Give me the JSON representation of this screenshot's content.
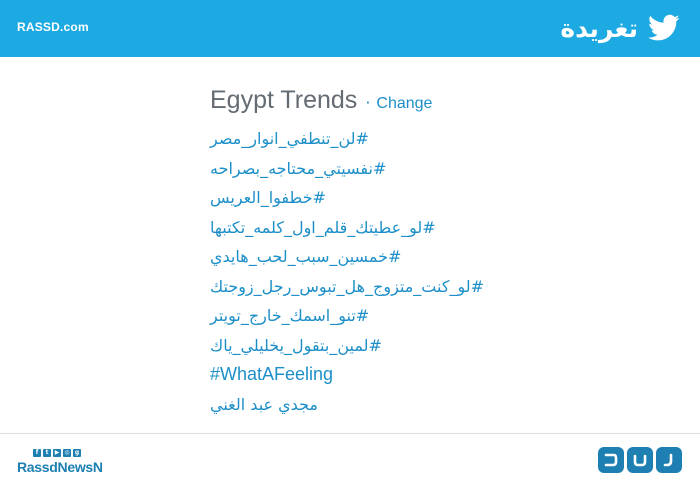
{
  "header": {
    "site_name": "RASSD.com",
    "brand_text": "تغريدة",
    "brand_icon": "twitter-bird-icon"
  },
  "trends": {
    "title": "Egypt Trends",
    "separator": "·",
    "change_label": "Change",
    "items": [
      "#لن_تنطفي_انوار_مصر",
      "#نفسيتي_محتاجه_بصراحه",
      "#خطفوا_العريس",
      "#لو_عطيتك_قلم_اول_كلمه_تكتبها",
      "#خمسين_سبب_لحب_هايدي",
      "#لو_كنت_متزوج_هل_تبوس_رجل_زوجتك",
      "#تنو_اسمك_خارج_تويتر",
      "#لمين_بتقول_يخليلي_ياك",
      "#WhatAFeeling",
      "مجدي عبد الغني"
    ]
  },
  "footer": {
    "social_icons": [
      "facebook-icon",
      "twitter-icon",
      "youtube-icon",
      "instagram-icon",
      "googleplus-icon"
    ],
    "social_glyphs": [
      "f",
      "t",
      "▶",
      "◎",
      "g"
    ],
    "handle": "RassdNewsN",
    "logo_icon": "rassd-logo-icon"
  },
  "colors": {
    "header_bg": "#1da9e1",
    "link": "#1d8fc8",
    "title": "#646b73",
    "footer_brand": "#1d7fb2"
  }
}
